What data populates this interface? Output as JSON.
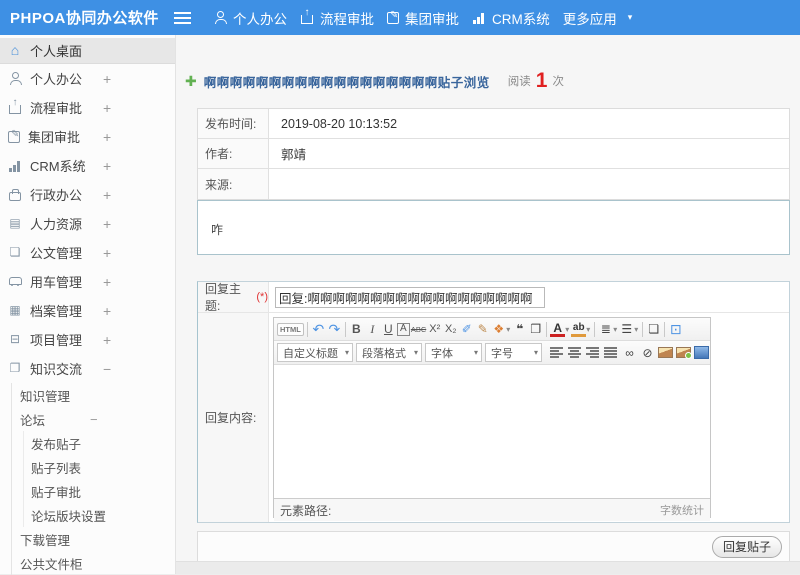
{
  "colors": {
    "topbar_blue": "#3e90e4",
    "title_blue": "#39659c",
    "count_red": "#e02020",
    "required_red": "#e03333",
    "plus_green": "#62b152"
  },
  "topbar": {
    "logo": "PHPOA协同办公软件",
    "nav": [
      {
        "label": "个人办公"
      },
      {
        "label": "流程审批"
      },
      {
        "label": "集团审批"
      },
      {
        "label": "CRM系统"
      },
      {
        "label": "更多应用",
        "caret": "▾"
      }
    ]
  },
  "sidebar": {
    "items": [
      {
        "label": "个人桌面",
        "exp": ""
      },
      {
        "label": "个人办公",
        "exp": "+"
      },
      {
        "label": "流程审批",
        "exp": "+"
      },
      {
        "label": "集团审批",
        "exp": "+"
      },
      {
        "label": "CRM系统",
        "exp": "+"
      },
      {
        "label": "行政办公",
        "exp": "+"
      },
      {
        "label": "人力资源",
        "exp": "+"
      },
      {
        "label": "公文管理",
        "exp": "+"
      },
      {
        "label": "用车管理",
        "exp": "+"
      },
      {
        "label": "档案管理",
        "exp": "+"
      },
      {
        "label": "项目管理",
        "exp": "+"
      },
      {
        "label": "知识交流",
        "exp": "−"
      },
      {
        "label": "知识管理",
        "exp": ""
      },
      {
        "label": "论坛",
        "exp": "−"
      },
      {
        "label": "发布贴子",
        "exp": ""
      },
      {
        "label": "贴子列表",
        "exp": ""
      },
      {
        "label": "贴子审批",
        "exp": ""
      },
      {
        "label": "论坛版块设置",
        "exp": ""
      },
      {
        "label": "下载管理",
        "exp": ""
      },
      {
        "label": "公共文件柜",
        "exp": ""
      }
    ]
  },
  "post": {
    "add_icon": "✚",
    "title": "啊啊啊啊啊啊啊啊啊啊啊啊啊啊啊啊啊啊贴子浏览",
    "read_label": "阅读",
    "read_count": "1",
    "read_unit": "次",
    "meta": [
      {
        "label": "发布时间:",
        "value": "2019-08-20 10:13:52"
      },
      {
        "label": "作者:",
        "value": "郭靖"
      },
      {
        "label": "来源:",
        "value": ""
      }
    ],
    "content_text": "咋"
  },
  "reply": {
    "subject_label": "回复主题:",
    "required_mark": "(*)",
    "subject_value": "回复:啊啊啊啊啊啊啊啊啊啊啊啊啊啊啊啊啊啊",
    "content_label": "回复内容:",
    "editor": {
      "row1": [
        {
          "name": "html-source-icon",
          "glyph": "HTML",
          "class": "lbl"
        },
        {
          "name": "separator",
          "class": "sep"
        },
        {
          "name": "undo-icon",
          "glyph": "↶",
          "class": "blue big"
        },
        {
          "name": "redo-icon",
          "glyph": "↷",
          "class": "blue big"
        },
        {
          "name": "separator",
          "class": "sep"
        },
        {
          "name": "bold-icon",
          "glyph": "B",
          "class": "b"
        },
        {
          "name": "italic-icon",
          "glyph": "I",
          "class": "i"
        },
        {
          "name": "underline-icon",
          "glyph": "U",
          "class": "u"
        },
        {
          "name": "font-border-icon",
          "glyph": "A",
          "class": "boxed"
        },
        {
          "name": "strikethrough-icon",
          "glyph": "ABC",
          "class": "abc"
        },
        {
          "name": "superscript-icon",
          "glyph": "X²",
          "class": "sm"
        },
        {
          "name": "subscript-icon",
          "glyph": "X₂",
          "class": "sm"
        },
        {
          "name": "eraser-icon",
          "glyph": "✐",
          "class": "blue"
        },
        {
          "name": "format-brush-icon",
          "glyph": "✎",
          "class": "tan"
        },
        {
          "name": "paint-color-icon",
          "glyph": "❖",
          "class": "orange"
        },
        {
          "name": "caret-down-icon",
          "glyph": "▾",
          "class": "caret"
        },
        {
          "name": "blockquote-icon",
          "glyph": "❝",
          "class": "b dark"
        },
        {
          "name": "paste-text-icon",
          "glyph": "❐",
          "class": "dark"
        },
        {
          "name": "separator",
          "class": "sep"
        },
        {
          "name": "font-color-icon",
          "glyph": "A",
          "class": "fcr"
        },
        {
          "name": "caret-down-icon",
          "glyph": "▾",
          "class": "caret"
        },
        {
          "name": "highlight-color-icon",
          "glyph": "ab",
          "class": "fco"
        },
        {
          "name": "caret-down-icon",
          "glyph": "▾",
          "class": "caret"
        },
        {
          "name": "separator",
          "class": "sep"
        },
        {
          "name": "ordered-list-icon",
          "glyph": "≣",
          "class": "dark"
        },
        {
          "name": "caret-down-icon",
          "glyph": "▾",
          "class": "caret"
        },
        {
          "name": "unordered-list-icon",
          "glyph": "☰",
          "class": "dark"
        },
        {
          "name": "caret-down-icon",
          "glyph": "▾",
          "class": "caret"
        },
        {
          "name": "separator",
          "class": "sep"
        },
        {
          "name": "new-document-icon",
          "glyph": "❏",
          "class": "dark"
        },
        {
          "name": "separator",
          "class": "sep"
        },
        {
          "name": "fullscreen-icon",
          "glyph": "⊡",
          "class": "blue big"
        }
      ],
      "dropdowns": [
        {
          "name": "heading-select",
          "label": "自定义标题",
          "caret": "▾",
          "class": "w74"
        },
        {
          "name": "paragraph-format-select",
          "label": "段落格式",
          "caret": "▾",
          "class": "w66"
        },
        {
          "name": "font-family-select",
          "label": "字体",
          "caret": "▾",
          "class": "w58"
        },
        {
          "name": "font-size-select",
          "label": "字号",
          "caret": "▾",
          "class": "w58"
        }
      ],
      "row2": [
        {
          "name": "align-left-icon",
          "class": "bars bl"
        },
        {
          "name": "align-center-icon",
          "class": "bars bc"
        },
        {
          "name": "align-right-icon",
          "class": "bars br"
        },
        {
          "name": "align-justify-icon",
          "class": "bars bj"
        },
        {
          "name": "link-icon",
          "glyph": "∞",
          "class": "dark"
        },
        {
          "name": "unlink-icon",
          "glyph": "⊘",
          "class": "dark"
        },
        {
          "name": "image-icon",
          "class": "imgic"
        },
        {
          "name": "screenshot-icon",
          "class": "imgic shot"
        },
        {
          "name": "media-icon",
          "class": "mediaic"
        },
        {
          "name": "table-icon",
          "glyph": "⊞",
          "class": "blue big"
        }
      ],
      "element_path": "元素路径:",
      "word_count": "字数统计"
    },
    "submit_label": "回复贴子"
  }
}
